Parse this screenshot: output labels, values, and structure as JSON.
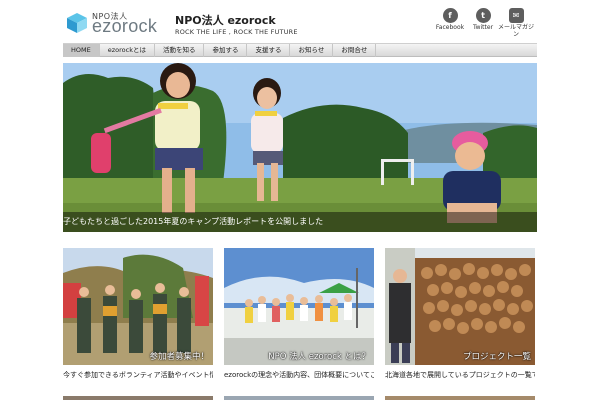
{
  "header": {
    "logo_small": "NPO法人",
    "logo_big": "ezorock",
    "site_title": "NPO法人 ezorock",
    "tagline": "ROCK THE LIFE , ROCK THE FUTURE"
  },
  "social": {
    "facebook": {
      "icon": "f",
      "label": "Facebook"
    },
    "twitter": {
      "icon": "t",
      "label": "Twitter"
    },
    "mail": {
      "icon": "✉",
      "label": "メールマガジン"
    }
  },
  "nav": {
    "items": [
      "HOME",
      "ezorockとは",
      "活動を知る",
      "参加する",
      "支援する",
      "お知らせ",
      "お問合せ"
    ]
  },
  "hero": {
    "caption": "子どもたちと過ごした2015年夏のキャンプ活動レポートを公開しました"
  },
  "cards": [
    {
      "label": "参加者募集中！",
      "desc": "今すぐ参加できるボランティア活動やイベント情報はこちら"
    },
    {
      "label": "NPO 法人 ezorock とは？",
      "desc": "ezorockの理念や活動内容、団体概要についてご紹介します"
    },
    {
      "label": "プロジェクト一覧",
      "desc": "北海道各地で展開しているプロジェクトの一覧です"
    }
  ],
  "colors": {
    "logo_cube_top": "#5bc4e8",
    "logo_cube_left": "#2e9ad0",
    "logo_cube_right": "#8fd9f2",
    "nav_active": "#c7c7c7"
  }
}
